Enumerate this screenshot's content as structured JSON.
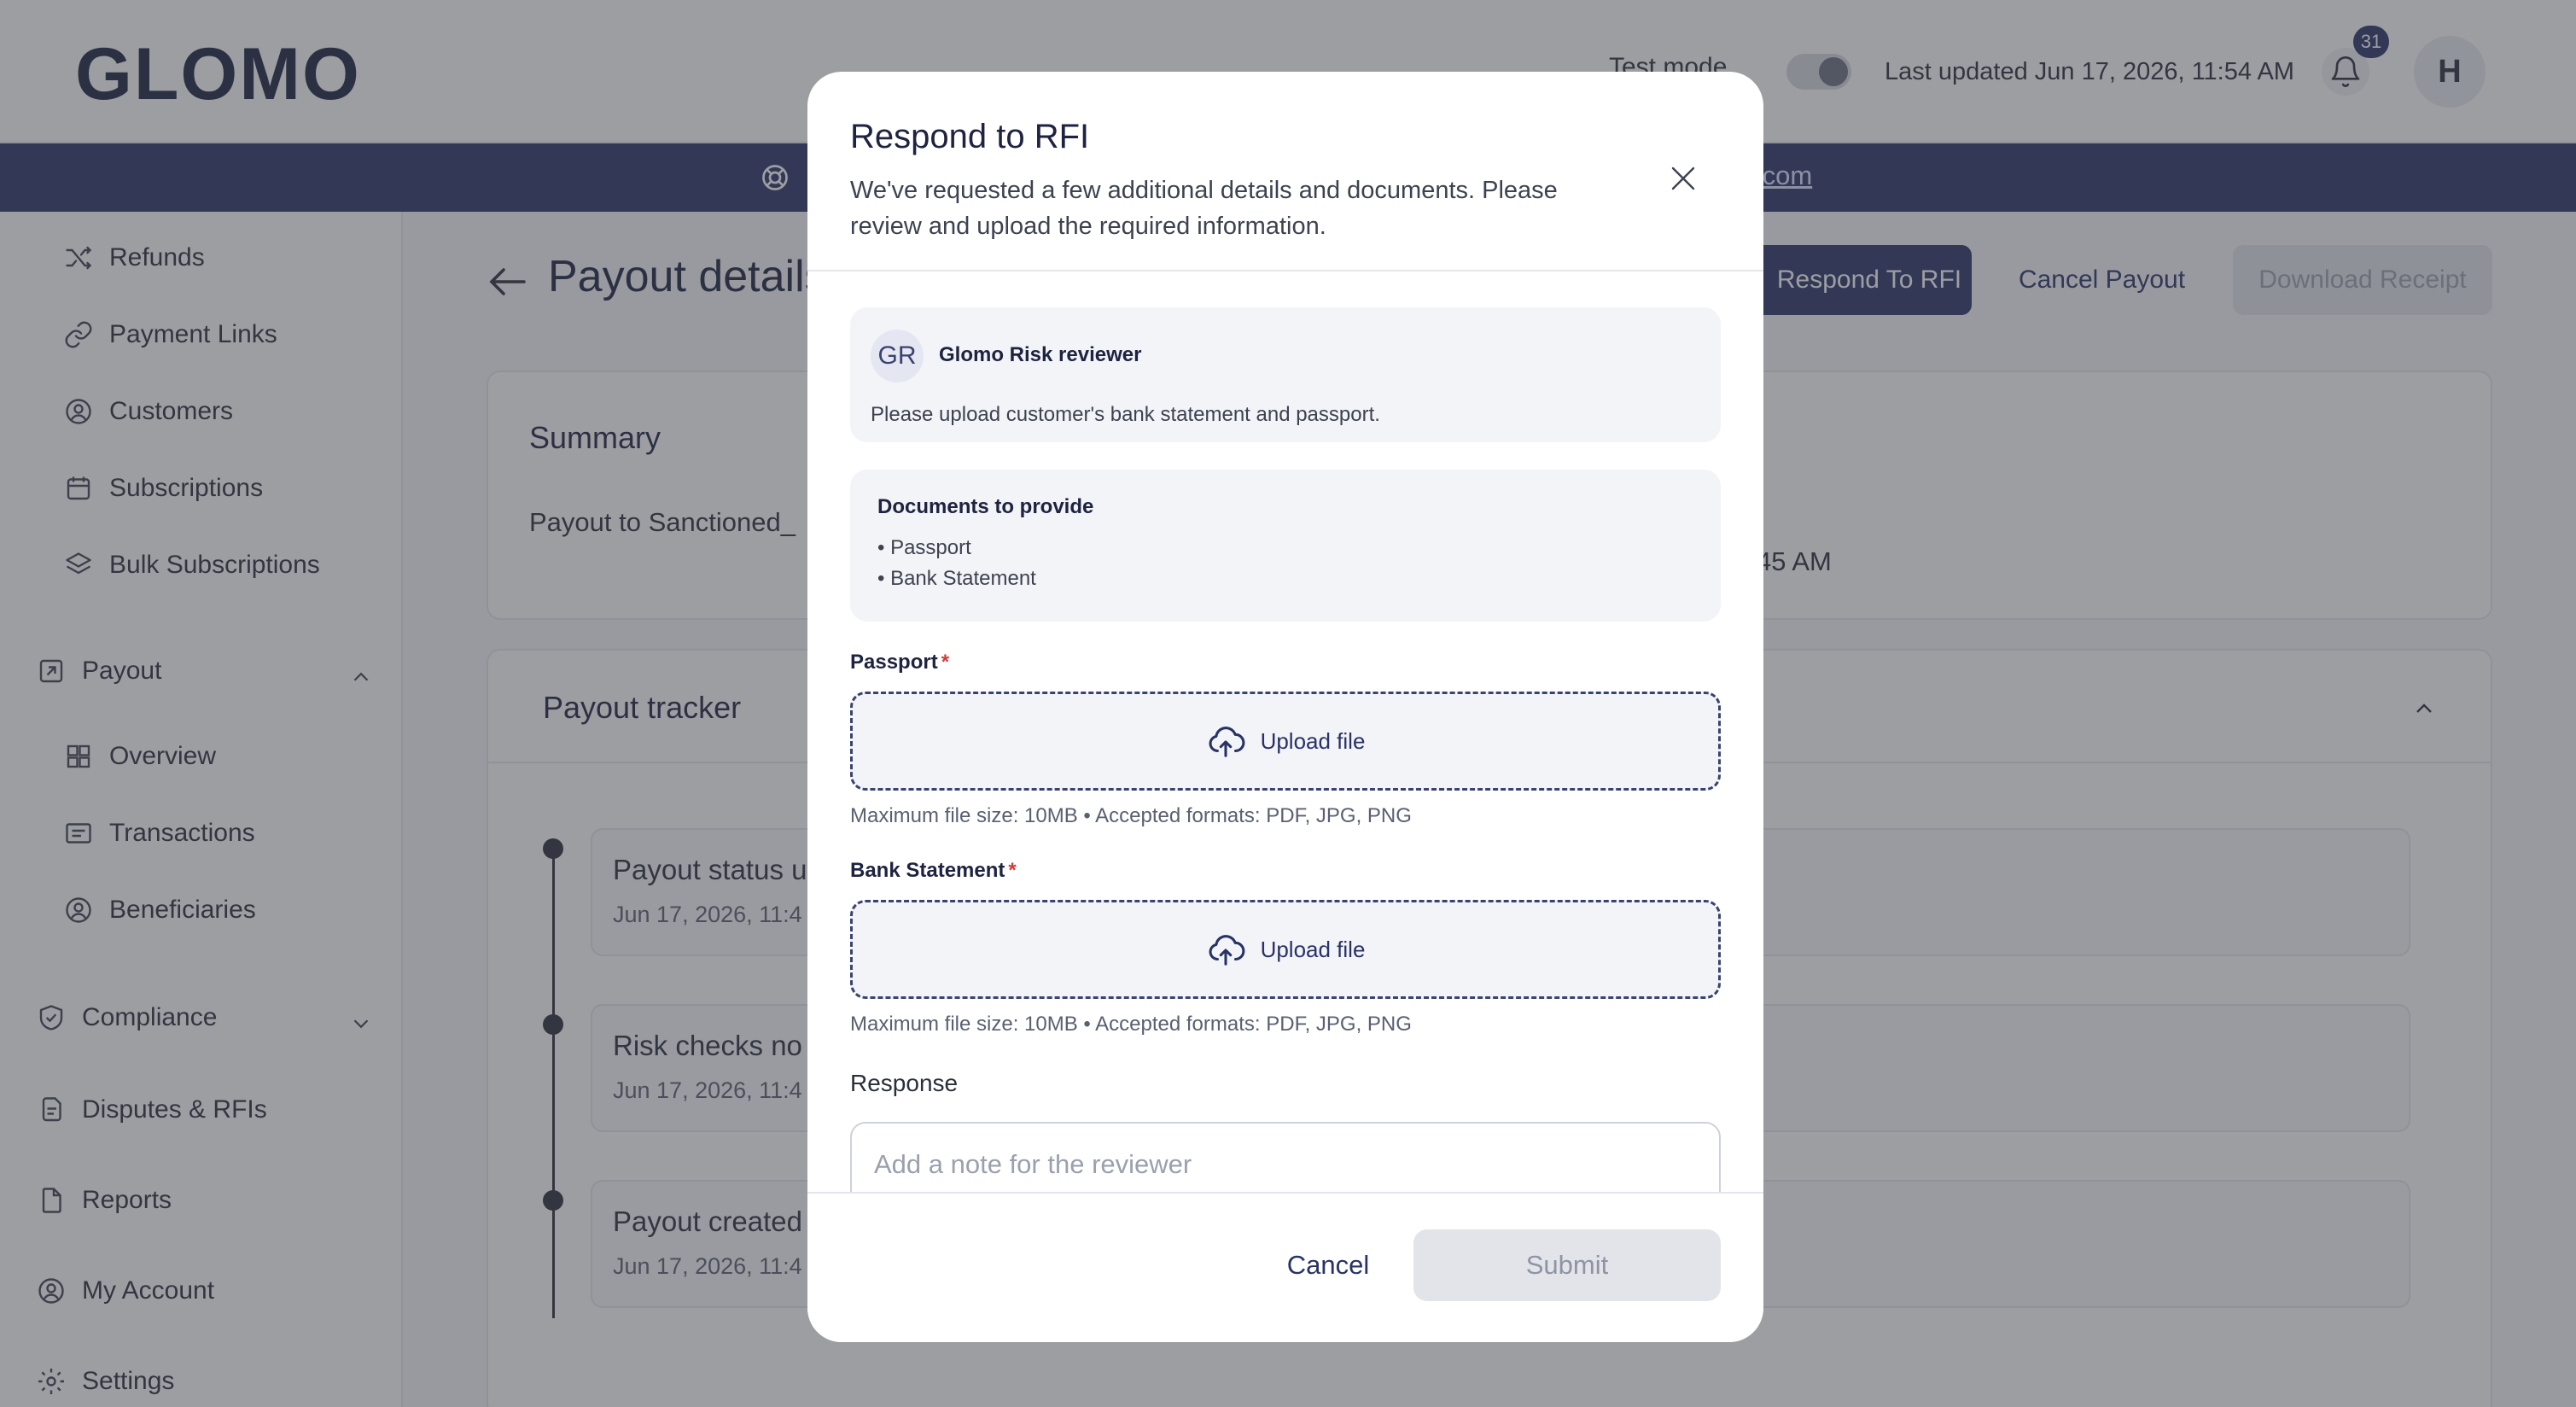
{
  "header": {
    "logo": "GLOMO",
    "test_mode_label": "Test mode",
    "last_updated": "Last updated Jun 17, 2026, 11:54 AM",
    "notification_count": "31",
    "avatar_initial": "H",
    "bell_icon": "bell-icon"
  },
  "banner": {
    "link_text": ".com",
    "icon": "support-icon"
  },
  "sidebar": {
    "items": [
      {
        "label": "Refunds",
        "icon": "shuffle-icon"
      },
      {
        "label": "Payment Links",
        "icon": "link-icon"
      },
      {
        "label": "Customers",
        "icon": "users-icon"
      },
      {
        "label": "Subscriptions",
        "icon": "calendar-icon"
      },
      {
        "label": "Bulk Subscriptions",
        "icon": "layers-icon"
      }
    ],
    "payout_section": {
      "label": "Payout",
      "icon": "payout-icon"
    },
    "payout_items": [
      {
        "label": "Overview",
        "icon": "grid-icon"
      },
      {
        "label": "Transactions",
        "icon": "list-icon"
      },
      {
        "label": "Beneficiaries",
        "icon": "users-icon"
      }
    ],
    "compliance": {
      "label": "Compliance",
      "icon": "shield-check-icon"
    },
    "bottom_items": [
      {
        "label": "Disputes & RFIs",
        "icon": "documents-icon"
      },
      {
        "label": "Reports",
        "icon": "file-icon"
      },
      {
        "label": "My Account",
        "icon": "user-circle-icon"
      },
      {
        "label": "Settings",
        "icon": "gear-icon"
      }
    ]
  },
  "main": {
    "page_title": "Payout details",
    "respond_rfi_button": "Respond To RFI",
    "cancel_payout_button": "Cancel Payout",
    "download_receipt_button": "Download Receipt",
    "summary": {
      "title": "Summary",
      "text": "Payout to Sanctioned_",
      "time_fragment": "45 AM"
    },
    "tracker": {
      "title": "Payout tracker",
      "items": [
        {
          "status": "Payout status u",
          "time": "Jun 17, 2026, 11:4"
        },
        {
          "status": "Risk checks no",
          "time": "Jun 17, 2026, 11:4"
        },
        {
          "status": "Payout created",
          "time": "Jun 17, 2026, 11:4"
        }
      ]
    }
  },
  "modal": {
    "title": "Respond to RFI",
    "subtitle": "We've requested a few additional details and documents. Please review and upload the required information.",
    "reviewer": {
      "initials": "GR",
      "name": "Glomo Risk reviewer",
      "message": "Please upload customer's bank statement and passport."
    },
    "documents": {
      "title": "Documents to provide",
      "items": [
        "• Passport",
        "• Bank Statement"
      ]
    },
    "passport": {
      "label": "Passport",
      "required_mark": "*",
      "upload_label": "Upload file",
      "hint": "Maximum file size: 10MB • Accepted formats: PDF, JPG, PNG"
    },
    "bank_statement": {
      "label": "Bank Statement",
      "required_mark": "*",
      "upload_label": "Upload file",
      "hint": "Maximum file size: 10MB • Accepted formats: PDF, JPG, PNG"
    },
    "response": {
      "label": "Response",
      "placeholder": "Add a note for the reviewer",
      "value": ""
    },
    "cancel_button": "Cancel",
    "submit_button": "Submit"
  },
  "colors": {
    "brand": "#283266",
    "overlay": "#3c3e46",
    "required": "#d23a3a",
    "disabled_bg": "#e2e4ea"
  }
}
